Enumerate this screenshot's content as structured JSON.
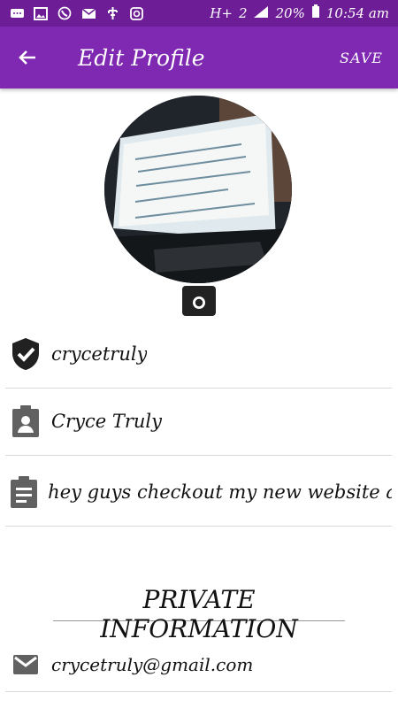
{
  "status": {
    "network": "H+",
    "sim": "2",
    "battery": "20%",
    "time": "10:54 am"
  },
  "header": {
    "title": "Edit Profile",
    "save_label": "SAVE"
  },
  "profile": {
    "username": "crycetruly",
    "full_name": "Cryce Truly",
    "bio": "hey guys checkout my new website at w"
  },
  "private": {
    "heading": "PRIVATE INFORMATION",
    "email": "crycetruly@gmail.com"
  },
  "colors": {
    "status_bar": "#6d1d96",
    "app_bar": "#7f28b1",
    "icon_gray": "#616161"
  }
}
